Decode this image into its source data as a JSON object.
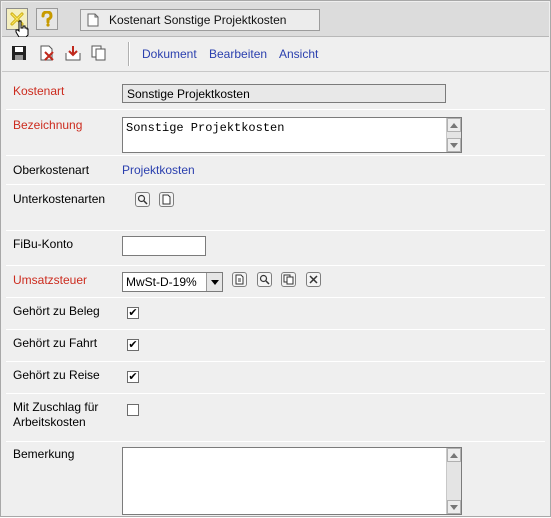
{
  "window": {
    "tab_title": "Kostenart Sonstige Projektkosten"
  },
  "toolbar": {
    "menus": [
      "Dokument",
      "Bearbeiten",
      "Ansicht"
    ]
  },
  "form": {
    "kostenart": {
      "label": "Kostenart",
      "value": "Sonstige Projektkosten"
    },
    "bezeichnung": {
      "label": "Bezeichnung",
      "value": "Sonstige Projektkosten"
    },
    "oberkostenart": {
      "label": "Oberkostenart",
      "value": "Projektkosten"
    },
    "unterkostenarten": {
      "label": "Unterkostenarten"
    },
    "fibu": {
      "label": "FiBu-Konto",
      "value": ""
    },
    "umsatzsteuer": {
      "label": "Umsatzsteuer",
      "value": "MwSt-D-19%"
    },
    "beleg": {
      "label": "Gehört zu Beleg",
      "checked": "✔"
    },
    "fahrt": {
      "label": "Gehört zu Fahrt",
      "checked": "✔"
    },
    "reise": {
      "label": "Gehört zu Reise",
      "checked": "✔"
    },
    "zuschlag": {
      "label_line1": "Mit Zuschlag für",
      "label_line2": "Arbeitskosten"
    },
    "bemerkung": {
      "label": "Bemerkung",
      "value": ""
    }
  },
  "colors": {
    "required_label": "#cc2b1e",
    "link": "#2a3fae",
    "row_bg": "#efefef"
  }
}
